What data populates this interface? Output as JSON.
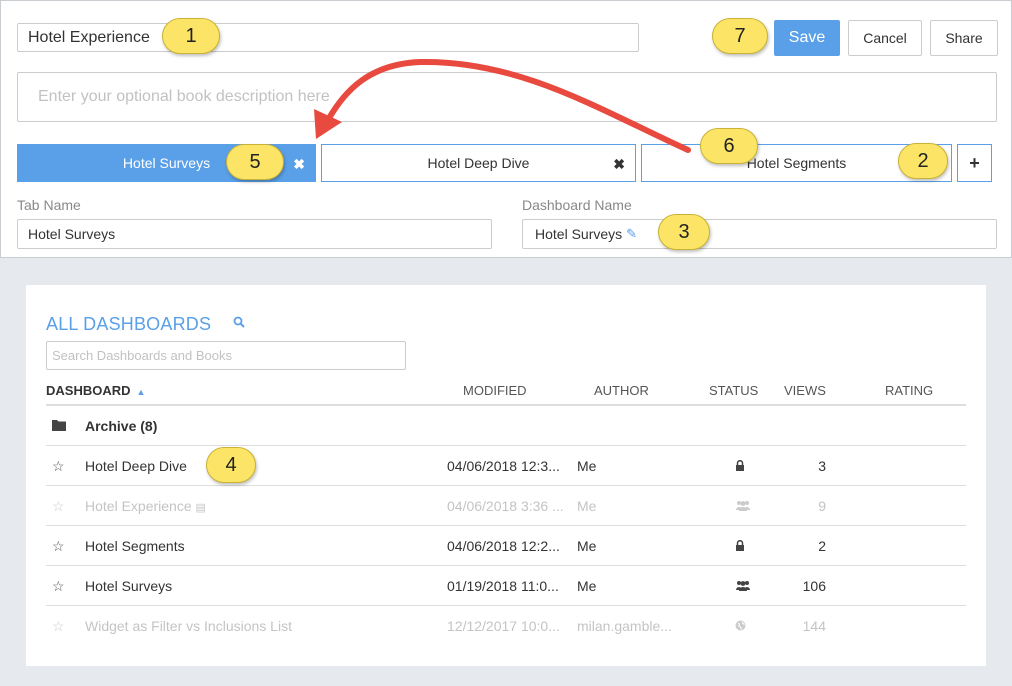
{
  "editor": {
    "book_title": "Hotel Experience",
    "description_placeholder": "Enter your optional book description here",
    "save_label": "Save",
    "cancel_label": "Cancel",
    "share_label": "Share",
    "tabs": [
      {
        "label": "Hotel Surveys",
        "active": true,
        "closable": true
      },
      {
        "label": "Hotel Deep Dive",
        "active": false,
        "closable": true
      },
      {
        "label": "Hotel Segments",
        "active": false,
        "closable": false
      }
    ],
    "add_tab_label": "+",
    "close_glyph": "✖",
    "tab_name_label": "Tab Name",
    "tab_name_value": "Hotel Surveys",
    "dashboard_name_label": "Dashboard Name",
    "dashboard_name_value": "Hotel Surveys"
  },
  "dashboards": {
    "title": "ALL DASHBOARDS",
    "search_placeholder": "Search Dashboards and Books",
    "columns": {
      "dashboard": "DASHBOARD",
      "modified": "MODIFIED",
      "author": "AUTHOR",
      "status": "STATUS",
      "views": "VIEWS",
      "rating": "RATING"
    },
    "folder": {
      "name": "Archive (8)",
      "icon": "folder-icon"
    },
    "rows": [
      {
        "name": "Hotel Deep Dive",
        "modified": "04/06/2018 12:3...",
        "author": "Me",
        "status": "lock-icon",
        "views": "3",
        "muted": false
      },
      {
        "name": "Hotel Experience",
        "modified": "04/06/2018 3:36 ...",
        "author": "Me",
        "status": "group-icon",
        "views": "9",
        "muted": true,
        "book": true
      },
      {
        "name": "Hotel Segments",
        "modified": "04/06/2018 12:2...",
        "author": "Me",
        "status": "lock-icon",
        "views": "2",
        "muted": false
      },
      {
        "name": "Hotel Surveys",
        "modified": "01/19/2018 11:0...",
        "author": "Me",
        "status": "group-icon",
        "views": "106",
        "muted": false
      },
      {
        "name": "Widget as Filter vs Inclusions List",
        "modified": "12/12/2017 10:0...",
        "author": "milan.gamble...",
        "status": "globe-icon",
        "views": "144",
        "muted": true
      }
    ]
  },
  "callouts": [
    "1",
    "2",
    "3",
    "4",
    "5",
    "6",
    "7"
  ],
  "colors": {
    "accent": "#5aa0e8",
    "callout": "#fce566",
    "arrow": "#e84a3f"
  }
}
